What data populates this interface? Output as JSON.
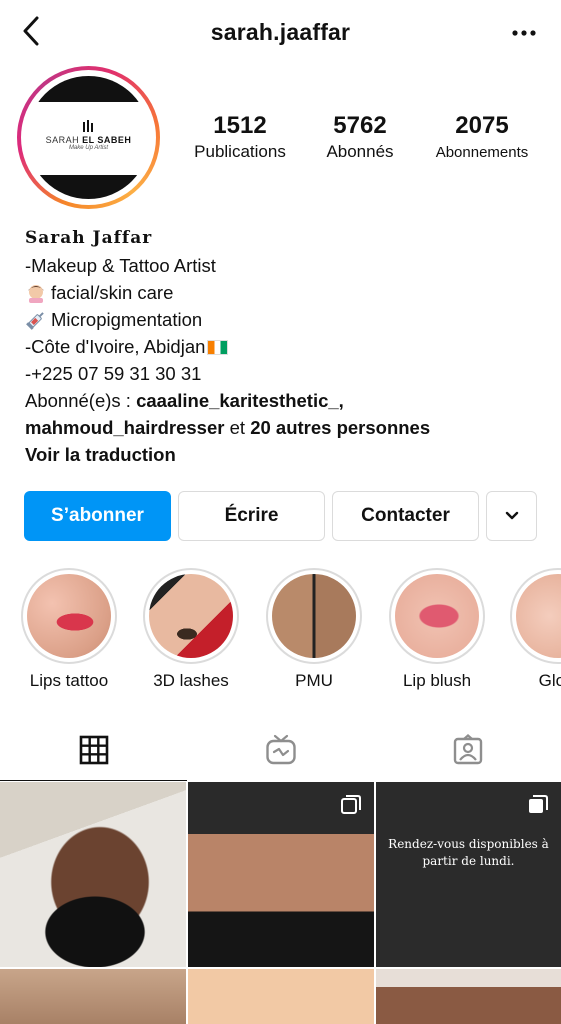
{
  "header": {
    "username": "sarah.jaaffar",
    "back_icon": "chevron-left-icon",
    "more_icon": "ellipsis-icon"
  },
  "profile": {
    "avatar_logo": {
      "name_a": "SARAH",
      "name_b": "EL SABEH",
      "subtitle": "Make Up Artist"
    },
    "stats": [
      {
        "value": "1512",
        "label": "Publications"
      },
      {
        "value": "5762",
        "label": "Abonnés"
      },
      {
        "value": "2075",
        "label": "Abonnements"
      }
    ]
  },
  "bio": {
    "name": "Sarah Jaffar",
    "lines": [
      "-Makeup & Tattoo Artist",
      "facial/skin care",
      "Micropigmentation",
      "-Côte d'Ivoire, Abidjan",
      "-+225 07 59 31 30 31"
    ],
    "followed_by_prefix": "Abonné(e)s : ",
    "followed_by_user1": "caaaline_karitesthetic_,",
    "followed_by_user2": "mahmoud_hairdresser",
    "followed_by_and": " et ",
    "followed_by_others": "20 autres personnes",
    "translate": "Voir la traduction"
  },
  "actions": {
    "follow": "S’abonner",
    "message": "Écrire",
    "contact": "Contacter"
  },
  "highlights": [
    {
      "label": "Lips tattoo"
    },
    {
      "label": "3D lashes"
    },
    {
      "label": "PMU"
    },
    {
      "label": "Lip blush"
    },
    {
      "label": "Glow"
    }
  ],
  "tabs": [
    {
      "icon": "grid-icon"
    },
    {
      "icon": "igtv-icon"
    },
    {
      "icon": "tagged-icon"
    }
  ],
  "posts": {
    "dark_post_text": "Rendez-vous disponibles à partir de lundi."
  },
  "colors": {
    "accent": "#0095f6",
    "border": "#dbdbdb"
  }
}
